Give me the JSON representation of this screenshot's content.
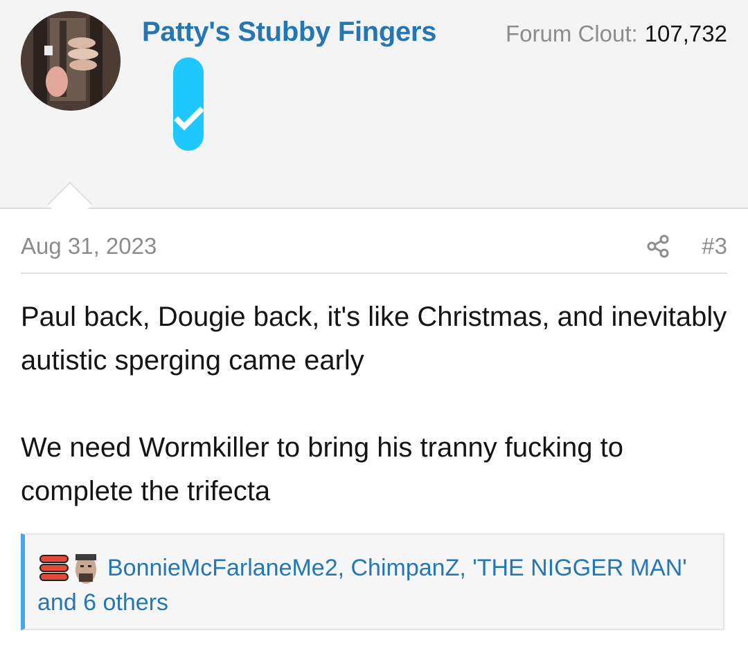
{
  "user": {
    "username": "Patty's Stubby Fingers",
    "clout_label": "Forum Clout:",
    "clout_value": "107,732"
  },
  "post": {
    "date": "Aug 31, 2023",
    "number": "#3",
    "paragraphs": [
      "Paul back, Dougie back, it's like Christmas, and inevitably autistic sperging came early",
      "We need Wormkiller to bring his tranny fucking to complete the trifecta"
    ]
  },
  "reactions": {
    "names": "BonnieMcFarlaneMe2, ChimpanZ, 'THE NIGGER MAN'",
    "others": "and 6 others"
  },
  "colors": {
    "link": "#2577b1",
    "badge": "#1ec8ff",
    "reaction_accent": "#47a7eb"
  },
  "icons": [
    "share-icon",
    "sausage-reaction-icon",
    "face-reaction-icon",
    "verified-badge-icon"
  ]
}
